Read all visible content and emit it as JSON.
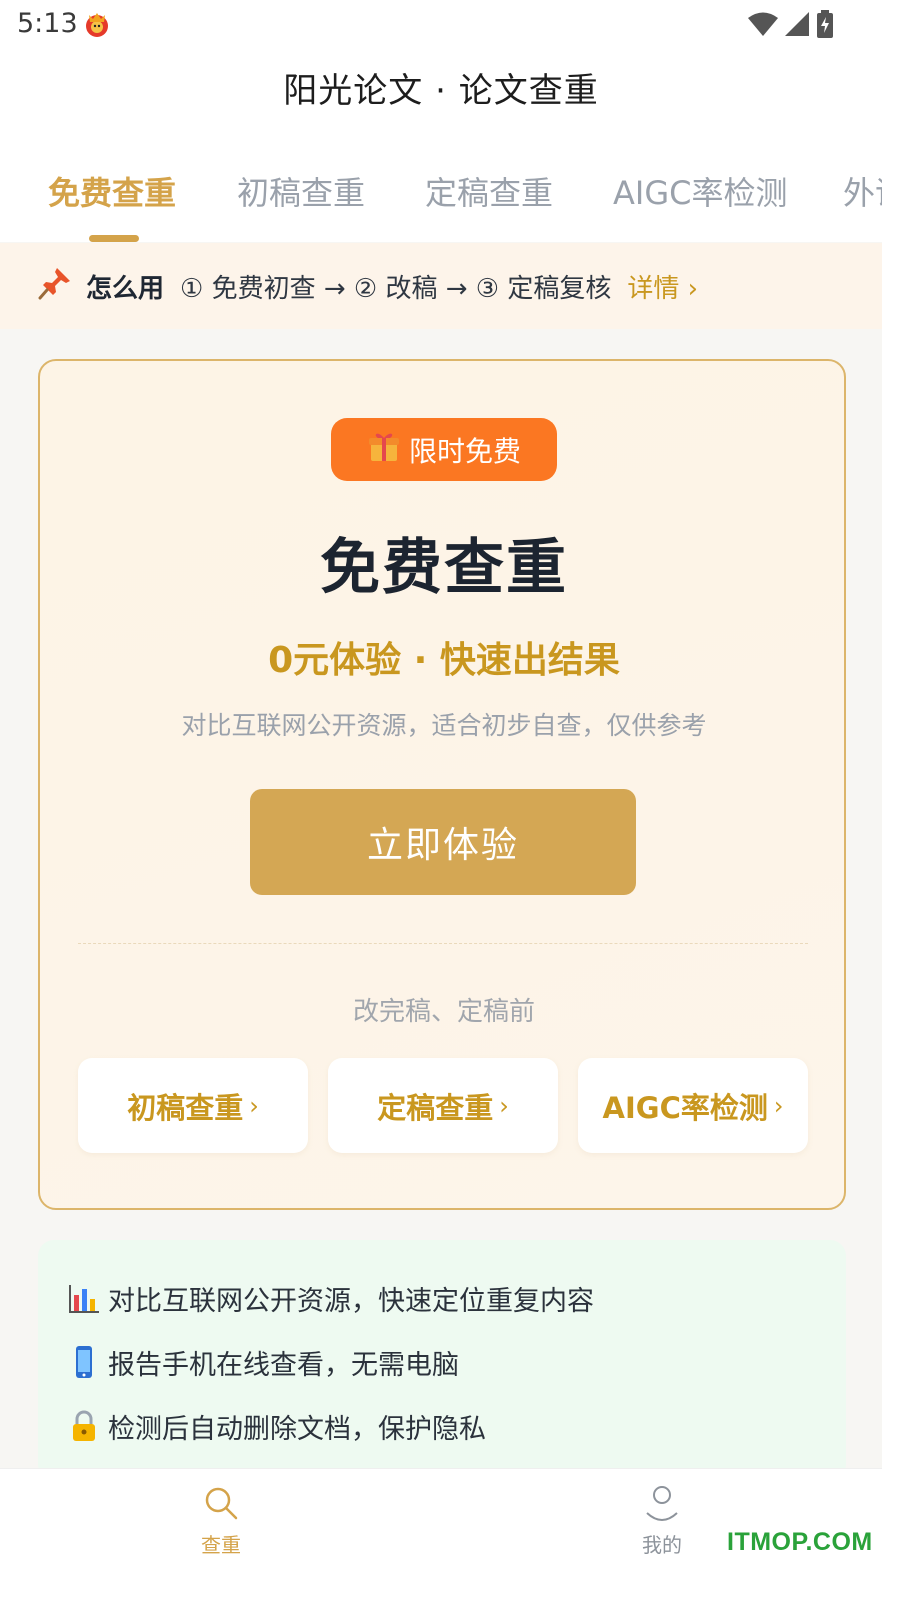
{
  "status_bar": {
    "time": "5:13"
  },
  "header": {
    "title": "阳光论文 · 论文查重"
  },
  "tabs": [
    {
      "label": "免费查重",
      "active": true
    },
    {
      "label": "初稿查重",
      "active": false
    },
    {
      "label": "定稿查重",
      "active": false
    },
    {
      "label": "AIGC率检测",
      "active": false
    },
    {
      "label": "外语",
      "active": false
    }
  ],
  "howto": {
    "icon": "pushpin-icon",
    "label": "怎么用",
    "steps": "① 免费初查 → ② 改稿 → ③ 定稿复核",
    "link": "详情 ›"
  },
  "card": {
    "badge": "限时免费",
    "badge_icon": "gift-icon",
    "title": "免费查重",
    "subtitle": "0元体验 · 快速出结果",
    "description": "对比互联网公开资源，适合初步自查，仅供参考",
    "cta": "立即体验",
    "note": "改完稿、定稿前",
    "options": [
      {
        "label": "初稿查重",
        "chevron": "›"
      },
      {
        "label": "定稿查重",
        "chevron": "›"
      },
      {
        "label": "AIGC率检测",
        "chevron": "›"
      }
    ]
  },
  "features": [
    {
      "icon": "bar-chart-icon",
      "text": "对比互联网公开资源，快速定位重复内容"
    },
    {
      "icon": "mobile-phone-icon",
      "text": "报告手机在线查看，无需电脑"
    },
    {
      "icon": "lock-icon",
      "text": "检测后自动删除文档，保护隐私"
    }
  ],
  "bottom_nav": [
    {
      "label": "查重",
      "icon": "search-icon",
      "active": true
    },
    {
      "label": "我的",
      "icon": "profile-icon",
      "active": false
    }
  ],
  "watermark": "ITMOP.COM",
  "colors": {
    "accent": "#d4a34a",
    "badge": "#fb7722",
    "cta": "#d4a754",
    "feature_bg": "#eefaf1",
    "howto_bg": "#fdf4ea"
  }
}
